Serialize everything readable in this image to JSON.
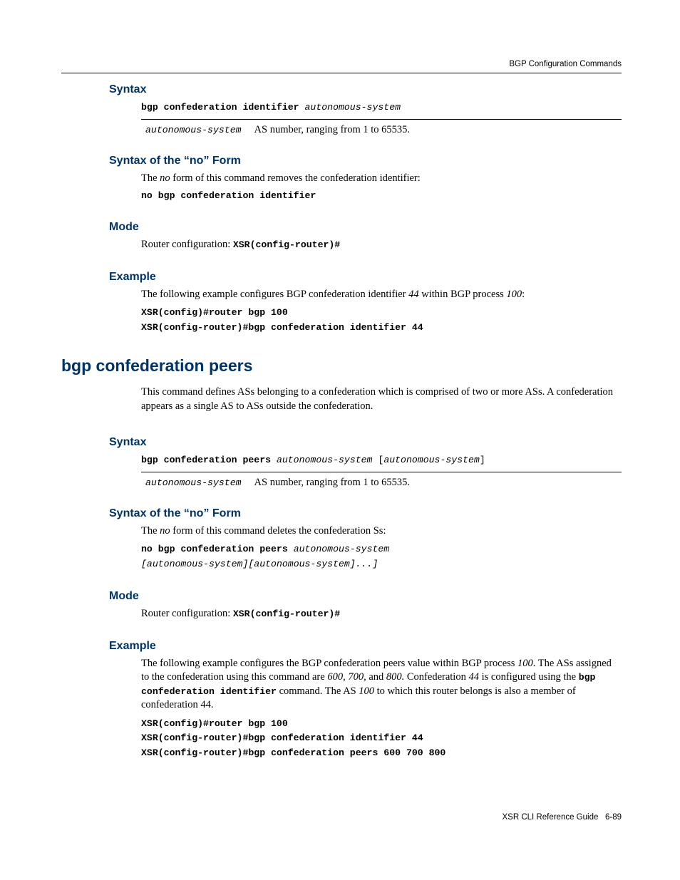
{
  "header": {
    "breadcrumb": "BGP Configuration Commands"
  },
  "sec1": {
    "syntax": {
      "title": "Syntax",
      "cmd_bold": "bgp confederation identifier ",
      "cmd_ital": "autonomous-system",
      "param_name": "autonomous-system",
      "param_desc": "AS number, ranging from 1 to 65535."
    },
    "noform": {
      "title": "Syntax of the “no” Form",
      "intro_pre": "The ",
      "intro_ital": "no",
      "intro_post": " form of this command removes the confederation identifier:",
      "cmd": "no bgp confederation identifier"
    },
    "mode": {
      "title": "Mode",
      "text_pre": "Router configuration: ",
      "text_mono": "XSR(config-router)#"
    },
    "example": {
      "title": "Example",
      "intro_a": "The following example configures BGP confederation identifier ",
      "intro_b": "44",
      "intro_c": " within BGP process ",
      "intro_d": "100",
      "intro_e": ":",
      "code1": "XSR(config)#router bgp 100",
      "code2": "XSR(config-router)#bgp confederation identifier 44"
    }
  },
  "cmd2": {
    "title": "bgp confederation peers",
    "intro": "This command defines ASs belonging to a confederation which is comprised of two or more ASs. A confederation appears as a single AS to ASs outside the confederation.",
    "syntax": {
      "title": "Syntax",
      "cmd_bold": "bgp confederation peers ",
      "cmd_ital1": "autonomous-system",
      "cmd_mid": " [",
      "cmd_ital2": "autonomous-system",
      "cmd_end": "]",
      "param_name": "autonomous-system",
      "param_desc": "AS number, ranging from 1 to 65535."
    },
    "noform": {
      "title": "Syntax of the “no” Form",
      "intro_pre": "The ",
      "intro_ital": "no",
      "intro_post": " form of this command deletes the confederation Ss:",
      "l1_b": "no bgp confederation peers ",
      "l1_i": "autonomous-system",
      "l2_a": "[",
      "l2_b": "autonomous-system",
      "l2_c": "][",
      "l2_d": "autonomous-system",
      "l2_e": "]...]"
    },
    "mode": {
      "title": "Mode",
      "text_pre": "Router configuration: ",
      "text_mono": "XSR(config-router)#"
    },
    "example": {
      "title": "Example",
      "p_a": "The following example configures the BGP confederation peers value within BGP process ",
      "p_b": "100",
      "p_c": ". The ASs assigned to the confederation using this command are ",
      "p_d": "600, 700,",
      "p_e": " and ",
      "p_f": "800.",
      "p_g": " Confederation ",
      "p_h": "44",
      "p_i": " is configured using the ",
      "p_j": "bgp confederation identifier",
      "p_k": " command. The AS ",
      "p_l": "100",
      "p_m": " to which this router belongs is also a member of confederation 44.",
      "code1": "XSR(config)#router bgp 100",
      "code2": "XSR(config-router)#bgp confederation identifier 44",
      "code3": "XSR(config-router)#bgp confederation peers 600 700 800"
    }
  },
  "footer": {
    "doc": "XSR CLI Reference Guide",
    "page": "6-89"
  }
}
